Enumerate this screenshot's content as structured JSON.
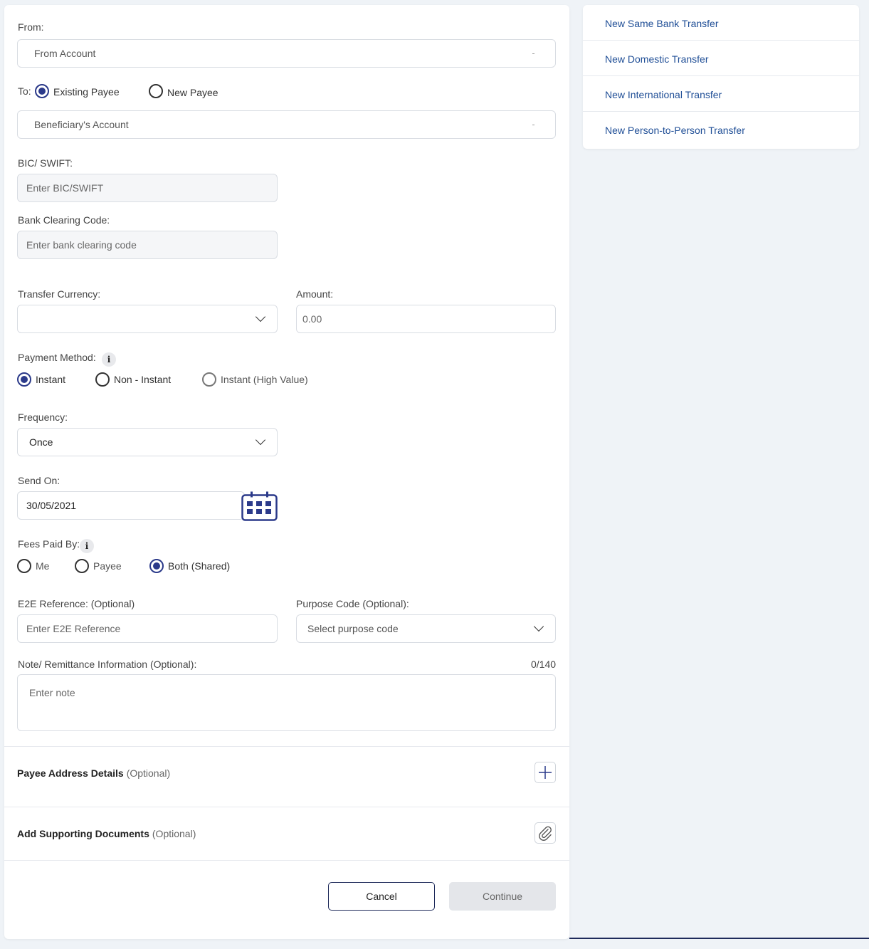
{
  "sidebar": {
    "items": [
      {
        "label": "New Same Bank Transfer"
      },
      {
        "label": "New Domestic Transfer"
      },
      {
        "label": "New International Transfer"
      },
      {
        "label": "New Person-to-Person Transfer"
      }
    ]
  },
  "form": {
    "from": {
      "label": "From:",
      "placeholder": "From Account"
    },
    "to": {
      "label": "To:",
      "options": [
        {
          "label": "Existing Payee",
          "selected": true
        },
        {
          "label": "New Payee",
          "selected": false
        }
      ],
      "placeholder": "Beneficiary's Account"
    },
    "bic": {
      "label": "BIC/ SWIFT:",
      "placeholder": "Enter BIC/SWIFT"
    },
    "clearing": {
      "label": "Bank Clearing Code:",
      "placeholder": "Enter bank clearing code"
    },
    "currency": {
      "label": "Transfer Currency:",
      "value": ""
    },
    "amount": {
      "label": "Amount:",
      "placeholder": "0.00"
    },
    "payment_method": {
      "label": "Payment Method:",
      "info_icon": "i",
      "options": [
        {
          "label": "Instant",
          "selected": true
        },
        {
          "label": "Non - Instant",
          "selected": false
        },
        {
          "label": "Instant (High Value)",
          "selected": false
        }
      ]
    },
    "frequency": {
      "label": "Frequency:",
      "value": "Once"
    },
    "send_on": {
      "label": "Send On:",
      "value": "30/05/2021"
    },
    "fees": {
      "label": "Fees Paid By:",
      "info_icon": "i",
      "options": [
        {
          "label": "Me",
          "selected": false
        },
        {
          "label": "Payee",
          "selected": false
        },
        {
          "label": "Both (Shared)",
          "selected": true
        }
      ]
    },
    "e2e": {
      "label": "E2E Reference: (Optional)",
      "placeholder": "Enter E2E Reference"
    },
    "purpose": {
      "label": "Purpose Code (Optional):",
      "placeholder": "Select purpose code"
    },
    "note": {
      "label": "Note/ Remittance Information (Optional):",
      "counter": "0/140",
      "placeholder": "Enter note"
    }
  },
  "sections": {
    "address": {
      "title": "Payee Address Details",
      "optional": "(Optional)",
      "icon": "plus-icon"
    },
    "documents": {
      "title": "Add Supporting Documents",
      "optional": "(Optional)",
      "icon": "paperclip-icon"
    }
  },
  "actions": {
    "cancel": "Cancel",
    "continue": "Continue"
  },
  "colors": {
    "accent": "#2b3a8a",
    "link": "#1f4e96",
    "background": "#eff3f7"
  }
}
